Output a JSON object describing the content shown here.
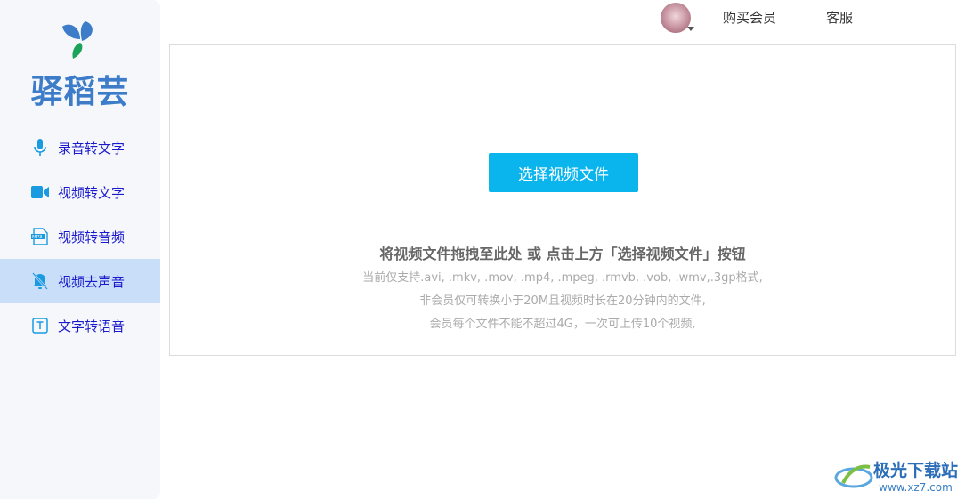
{
  "brand": {
    "name": "驿稻芸"
  },
  "sidebar": {
    "items": [
      {
        "label": "录音转文字",
        "icon": "microphone-icon"
      },
      {
        "label": "视频转文字",
        "icon": "video-camera-icon"
      },
      {
        "label": "视频转音频",
        "icon": "mp3-file-icon"
      },
      {
        "label": "视频去声音",
        "icon": "bell-off-icon",
        "active": true
      },
      {
        "label": "文字转语音",
        "icon": "text-box-icon"
      }
    ]
  },
  "header": {
    "buy_member": "购买会员",
    "service": "客服"
  },
  "main": {
    "select_button": "选择视频文件",
    "drag_hint": "将视频文件拖拽至此处 或 点击上方「选择视频文件」按钮",
    "formats": "当前仅支持.avi, .mkv, .mov, .mp4, .mpeg, .rmvb, .vob, .wmv,.3gp格式,",
    "limit_free": "非会员仅可转换小于20M且视频时长在20分钟内的文件,",
    "limit_member": "会员每个文件不能不超过4G，一次可上传10个视频,"
  },
  "watermark": {
    "name": "极光下载站",
    "url": "www.xz7.com"
  },
  "colors": {
    "accent": "#0ab5ee",
    "active_bg": "#c9def8",
    "brand": "#3d7cc9"
  }
}
